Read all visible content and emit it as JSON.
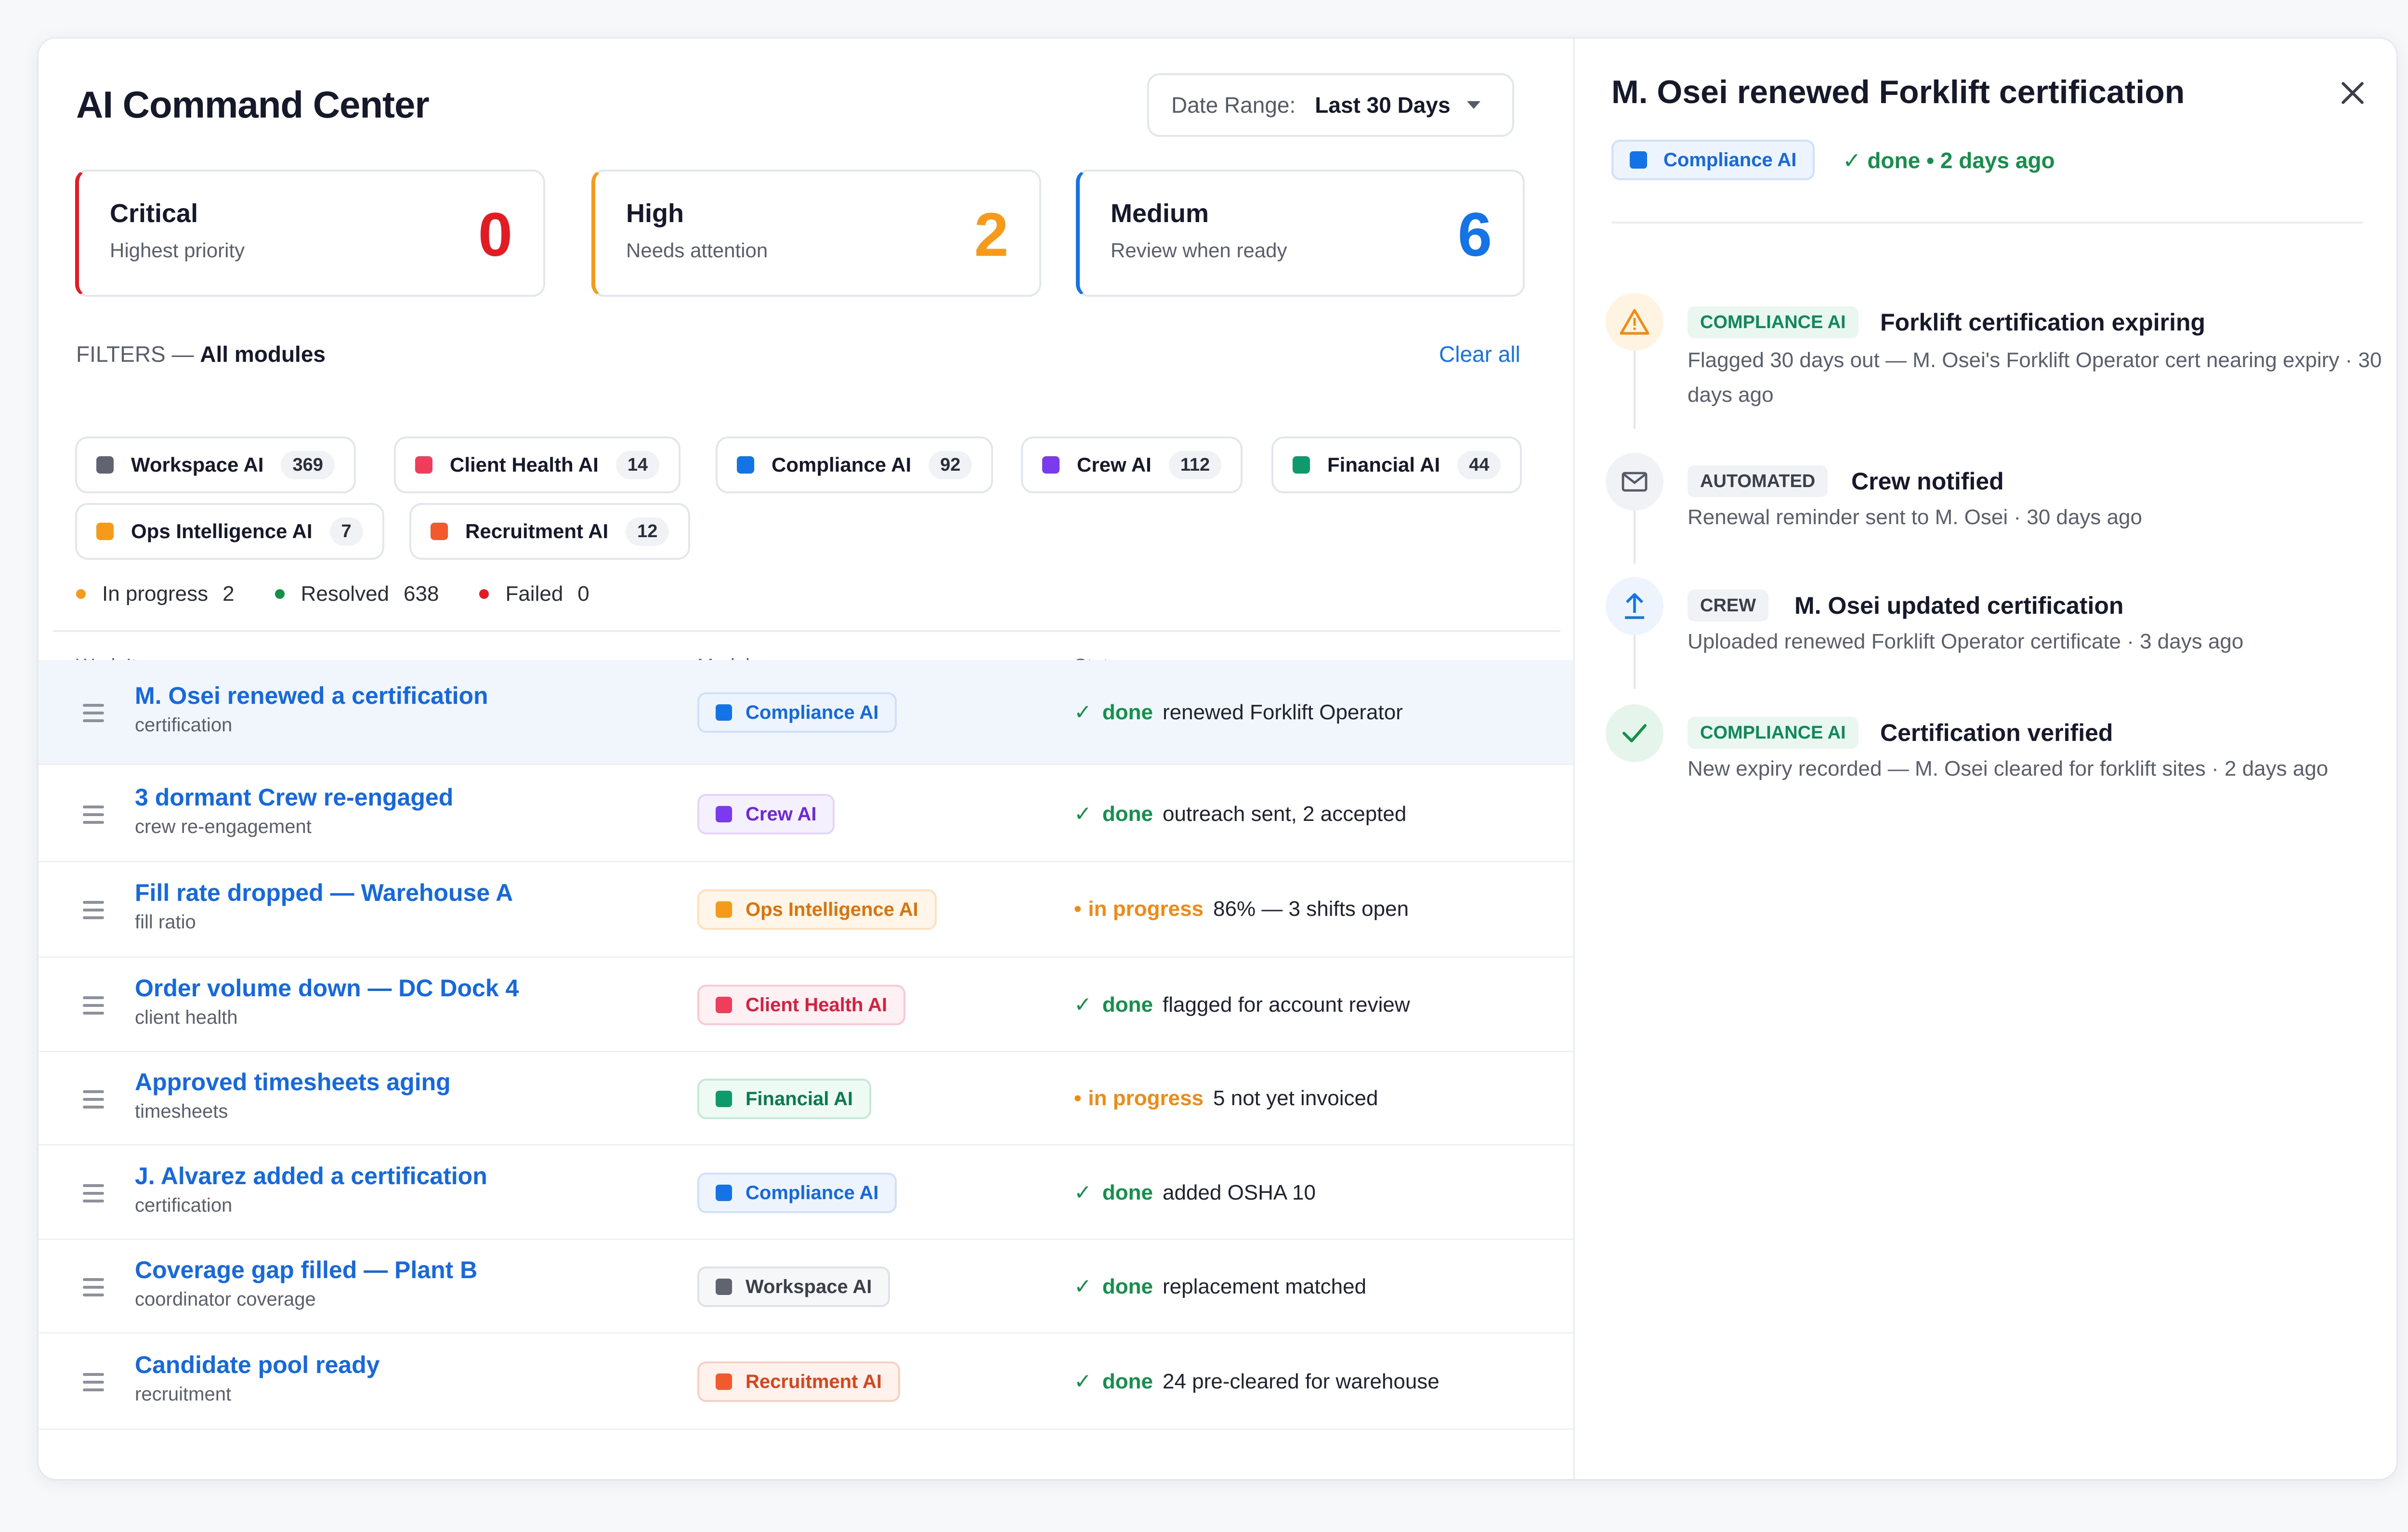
{
  "header": {
    "title": "AI Command Center",
    "date_range_label": "Date Range:",
    "date_range_value": "Last 30 Days"
  },
  "severity": {
    "critical": {
      "title": "Critical",
      "sub": "Highest priority",
      "count": "0",
      "color": "#e31b23"
    },
    "high": {
      "title": "High",
      "sub": "Needs attention",
      "count": "2",
      "color": "#f59a19"
    },
    "medium": {
      "title": "Medium",
      "sub": "Review when ready",
      "count": "6",
      "color": "#1473e6"
    }
  },
  "filters": {
    "label": "FILTERS —",
    "scope": "All modules",
    "clear_all": "Clear all",
    "chips": [
      {
        "label": "Workspace AI",
        "count": "369",
        "color": "#5f6470"
      },
      {
        "label": "Client Health AI",
        "count": "14",
        "color": "#ef3e5b"
      },
      {
        "label": "Compliance AI",
        "count": "92",
        "color": "#1473e6"
      },
      {
        "label": "Crew AI",
        "count": "112",
        "color": "#7c3aed"
      },
      {
        "label": "Financial AI",
        "count": "44",
        "color": "#0e9a6a"
      },
      {
        "label": "Ops Intelligence AI",
        "count": "7",
        "color": "#f59a19"
      },
      {
        "label": "Recruitment AI",
        "count": "12",
        "color": "#f25a2e"
      }
    ]
  },
  "stats": {
    "in_progress_label": "In progress",
    "in_progress": "2",
    "resolved_label": "Resolved",
    "resolved": "638",
    "failed_label": "Failed",
    "failed": "0"
  },
  "table": {
    "columns": [
      "Work Item",
      "Module",
      "Status"
    ],
    "rows": [
      {
        "title": "M. Osei renewed a certification",
        "sub": "certification",
        "module": "Compliance AI",
        "status": "done",
        "status_text": "renewed Forklift Operator"
      },
      {
        "title": "3 dormant Crew re-engaged",
        "sub": "crew re-engagement",
        "module": "Crew AI",
        "status": "done",
        "status_text": "outreach sent, 2 accepted"
      },
      {
        "title": "Fill rate dropped — Warehouse A",
        "sub": "fill ratio",
        "module": "Ops Intelligence AI",
        "status": "in progress",
        "status_text": "86% — 3 shifts open"
      },
      {
        "title": "Order volume down — DC Dock 4",
        "sub": "client health",
        "module": "Client Health AI",
        "status": "done",
        "status_text": "flagged for account review"
      },
      {
        "title": "Approved timesheets aging",
        "sub": "timesheets",
        "module": "Financial AI",
        "status": "in progress",
        "status_text": "5 not yet invoiced"
      },
      {
        "title": "J. Alvarez added a certification",
        "sub": "certification",
        "module": "Compliance AI",
        "status": "done",
        "status_text": "added OSHA 10"
      },
      {
        "title": "Coverage gap filled — Plant B",
        "sub": "coordinator coverage",
        "module": "Workspace AI",
        "status": "done",
        "status_text": "replacement matched"
      },
      {
        "title": "Candidate pool ready",
        "sub": "recruitment",
        "module": "Recruitment AI",
        "status": "done",
        "status_text": "24 pre-cleared for warehouse"
      }
    ]
  },
  "detail": {
    "title": "M. Osei renewed Forklift certification",
    "module": "Compliance AI",
    "status": "✓ done • 2 days ago",
    "timeline": [
      {
        "badge": "COMPLIANCE AI",
        "icon": "warning-icon",
        "head": "Forklift certification expiring",
        "body": "Flagged 30 days out — M. Osei's Forklift Operator cert nearing expiry · 30 days ago"
      },
      {
        "badge": "AUTOMATED",
        "icon": "mail-icon",
        "head": "Crew notified",
        "body": "Renewal reminder sent to M. Osei · 30 days ago"
      },
      {
        "badge": "CREW",
        "icon": "upload-icon",
        "head": "M. Osei updated certification",
        "body": "Uploaded renewed Forklift Operator certificate · 3 days ago"
      },
      {
        "badge": "COMPLIANCE AI",
        "icon": "check-icon",
        "head": "Certification verified",
        "body": "New expiry recorded — M. Osei cleared for forklift sites · 2 days ago"
      }
    ]
  }
}
